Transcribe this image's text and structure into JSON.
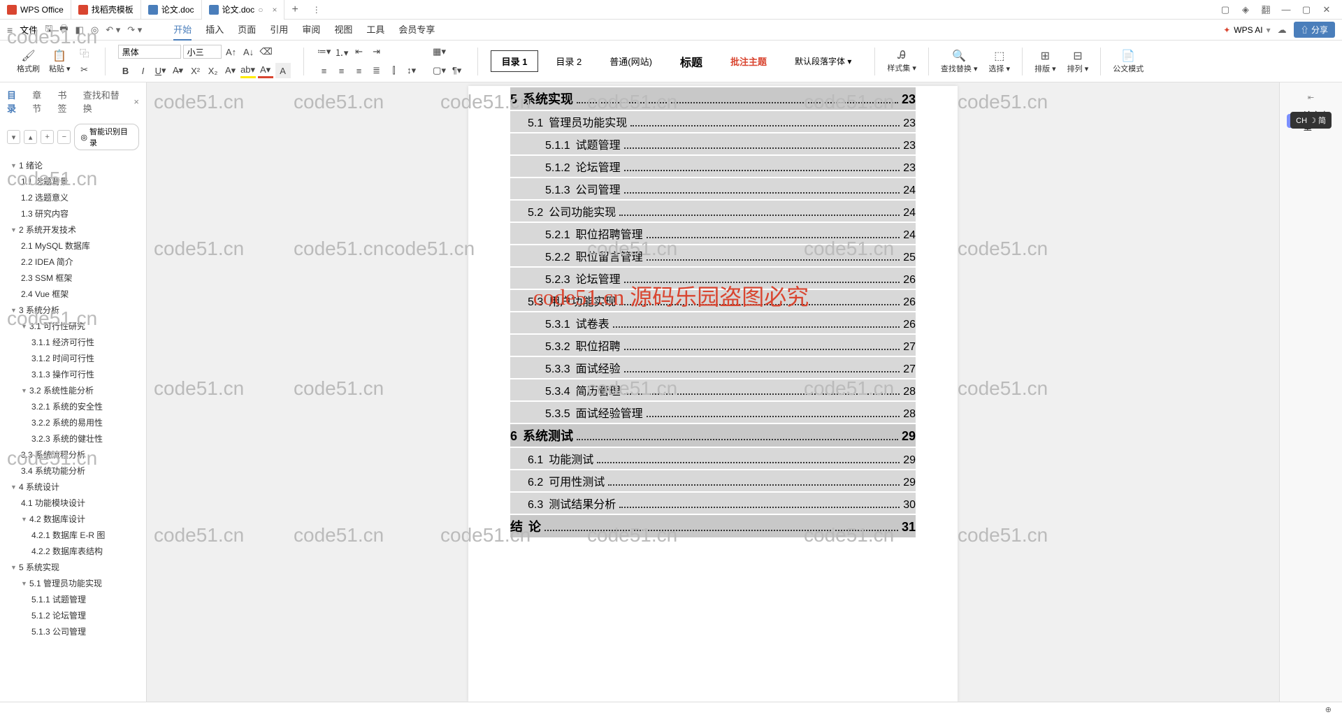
{
  "tabs": {
    "app": "WPS Office",
    "template": "找稻壳模板",
    "doc1": "论文.doc",
    "doc2": "论文.doc"
  },
  "menu": {
    "file": "文件",
    "items": [
      "开始",
      "插入",
      "页面",
      "引用",
      "审阅",
      "视图",
      "工具",
      "会员专享"
    ],
    "wps_ai": "WPS AI",
    "share": "分享"
  },
  "toolbar": {
    "format_painter": "格式刷",
    "paste": "粘贴",
    "font": "黑体",
    "size": "小三",
    "styles": [
      "目录 1",
      "目录 2",
      "普通(网站)",
      "标题",
      "批注主题",
      "默认段落字体"
    ],
    "style_set": "样式集",
    "find_replace": "查找替换",
    "select": "选择",
    "layout_v": "排版",
    "layout_h": "排列",
    "gov_mode": "公文模式"
  },
  "sidebar": {
    "tabs": [
      "目录",
      "章节",
      "书签",
      "查找和替换"
    ],
    "smart_toc": "智能识别目录",
    "outline": [
      {
        "lvl": 1,
        "t": "1 绪论",
        "exp": true
      },
      {
        "lvl": 2,
        "t": "1.1 选题背景"
      },
      {
        "lvl": 2,
        "t": "1.2 选题意义"
      },
      {
        "lvl": 2,
        "t": "1.3 研究内容"
      },
      {
        "lvl": 1,
        "t": "2 系统开发技术",
        "exp": true
      },
      {
        "lvl": 2,
        "t": "2.1 MySQL 数据库"
      },
      {
        "lvl": 2,
        "t": "2.2 IDEA 简介"
      },
      {
        "lvl": 2,
        "t": "2.3 SSM 框架"
      },
      {
        "lvl": 2,
        "t": "2.4 Vue 框架"
      },
      {
        "lvl": 1,
        "t": "3 系统分析",
        "exp": true
      },
      {
        "lvl": 2,
        "t": "3.1 可行性研究",
        "exp": true
      },
      {
        "lvl": 3,
        "t": "3.1.1 经济可行性"
      },
      {
        "lvl": 3,
        "t": "3.1.2 时间可行性"
      },
      {
        "lvl": 3,
        "t": "3.1.3 操作可行性"
      },
      {
        "lvl": 2,
        "t": "3.2 系统性能分析",
        "exp": true
      },
      {
        "lvl": 3,
        "t": "3.2.1 系统的安全性"
      },
      {
        "lvl": 3,
        "t": "3.2.2 系统的易用性"
      },
      {
        "lvl": 3,
        "t": "3.2.3 系统的健壮性"
      },
      {
        "lvl": 2,
        "t": "3.3 系统流程分析"
      },
      {
        "lvl": 2,
        "t": "3.4 系统功能分析"
      },
      {
        "lvl": 1,
        "t": "4 系统设计",
        "exp": true
      },
      {
        "lvl": 2,
        "t": "4.1 功能模块设计"
      },
      {
        "lvl": 2,
        "t": "4.2 数据库设计",
        "exp": true
      },
      {
        "lvl": 3,
        "t": "4.2.1 数据库 E-R 图"
      },
      {
        "lvl": 3,
        "t": "4.2.2 数据库表结构"
      },
      {
        "lvl": 1,
        "t": "5 系统实现",
        "exp": true
      },
      {
        "lvl": 2,
        "t": "5.1 管理员功能实现",
        "exp": true
      },
      {
        "lvl": 3,
        "t": "5.1.1 试题管理"
      },
      {
        "lvl": 3,
        "t": "5.1.2 论坛管理"
      },
      {
        "lvl": 3,
        "t": "5.1.3 公司管理"
      }
    ]
  },
  "toc": [
    {
      "lvl": 1,
      "num": "5",
      "title": "系统实现",
      "page": "23"
    },
    {
      "lvl": 2,
      "num": "5.1",
      "title": "管理员功能实现",
      "page": "23"
    },
    {
      "lvl": 3,
      "num": "5.1.1",
      "title": "试题管理",
      "page": "23"
    },
    {
      "lvl": 3,
      "num": "5.1.2",
      "title": "论坛管理",
      "page": "23"
    },
    {
      "lvl": 3,
      "num": "5.1.3",
      "title": "公司管理",
      "page": "24"
    },
    {
      "lvl": 2,
      "num": "5.2",
      "title": "公司功能实现",
      "page": "24"
    },
    {
      "lvl": 3,
      "num": "5.2.1",
      "title": "职位招聘管理",
      "page": "24"
    },
    {
      "lvl": 3,
      "num": "5.2.2",
      "title": "职位留言管理",
      "page": "25"
    },
    {
      "lvl": 3,
      "num": "5.2.3",
      "title": "论坛管理",
      "page": "26"
    },
    {
      "lvl": 2,
      "num": "5.3",
      "title": "用户功能实现",
      "page": "26"
    },
    {
      "lvl": 3,
      "num": "5.3.1",
      "title": "试卷表",
      "page": "26"
    },
    {
      "lvl": 3,
      "num": "5.3.2",
      "title": "职位招聘",
      "page": "27"
    },
    {
      "lvl": 3,
      "num": "5.3.3",
      "title": "面试经验",
      "page": "27"
    },
    {
      "lvl": 3,
      "num": "5.3.4",
      "title": "简历管理",
      "page": "28"
    },
    {
      "lvl": 3,
      "num": "5.3.5",
      "title": "面试经验管理",
      "page": "28"
    },
    {
      "lvl": 1,
      "num": "6",
      "title": "系统测试",
      "page": "29"
    },
    {
      "lvl": 2,
      "num": "6.1",
      "title": "功能测试",
      "page": "29"
    },
    {
      "lvl": 2,
      "num": "6.2",
      "title": "可用性测试",
      "page": "29"
    },
    {
      "lvl": 2,
      "num": "6.3",
      "title": "测试结果分析",
      "page": "30"
    },
    {
      "lvl": 1,
      "num": "结",
      "title": "论",
      "page": "31"
    }
  ],
  "right_rail": {
    "check": "论文查重"
  },
  "overlay": {
    "red": "code51.cn 源码乐园盗图必究",
    "watermark": "code51.cn",
    "ime": "CH ☽ 简"
  }
}
